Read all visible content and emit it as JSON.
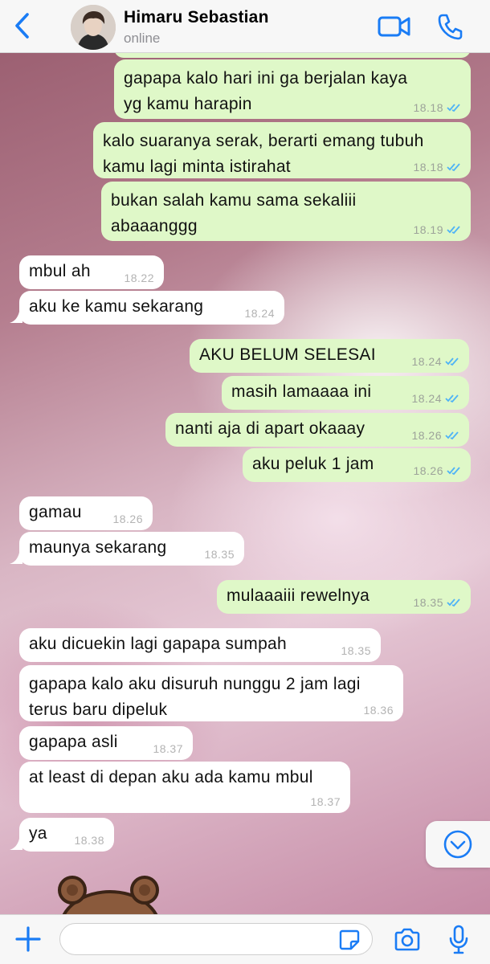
{
  "header": {
    "contact_name": "Himaru Sebastian",
    "status": "online",
    "back_icon": "chevron-left-icon",
    "video_icon": "video-camera-icon",
    "call_icon": "phone-icon",
    "accent_color": "#1a7cf5"
  },
  "messages": [
    {
      "dir": "out",
      "text": "gapapa kalo hari ini ga berjalan kaya yg kamu harapin",
      "time": "18.18",
      "read": true
    },
    {
      "dir": "out",
      "text": "kalo suaranya serak, berarti emang tubuh kamu lagi minta istirahat",
      "time": "18.18",
      "read": true
    },
    {
      "dir": "out",
      "text": "bukan salah kamu sama sekaliii abaaanggg",
      "time": "18.19",
      "read": true
    },
    {
      "dir": "in",
      "text": "mbul ah",
      "time": "18.22"
    },
    {
      "dir": "in",
      "text": "aku ke kamu sekarang",
      "time": "18.24"
    },
    {
      "dir": "out",
      "text": "AKU BELUM SELESAI",
      "time": "18.24",
      "read": true
    },
    {
      "dir": "out",
      "text": "masih lamaaaa ini",
      "time": "18.24",
      "read": true
    },
    {
      "dir": "out",
      "text": "nanti aja di apart okaaay",
      "time": "18.26",
      "read": true
    },
    {
      "dir": "out",
      "text": "aku peluk 1 jam",
      "time": "18.26",
      "read": true
    },
    {
      "dir": "in",
      "text": "gamau",
      "time": "18.26"
    },
    {
      "dir": "in",
      "text": "maunya sekarang",
      "time": "18.35"
    },
    {
      "dir": "out",
      "text": "mulaaaiii rewelnya",
      "time": "18.35",
      "read": true
    },
    {
      "dir": "in",
      "text": "aku dicuekin lagi gapapa sumpah",
      "time": "18.35"
    },
    {
      "dir": "in",
      "text": "gapapa kalo aku disuruh nunggu 2 jam lagi terus baru dipeluk",
      "time": "18.36"
    },
    {
      "dir": "in",
      "text": "gapapa asli",
      "time": "18.37"
    },
    {
      "dir": "in",
      "text": "at least di depan aku ada kamu mbul",
      "time": "18.37"
    },
    {
      "dir": "in",
      "text": "ya",
      "time": "18.38"
    }
  ],
  "colors": {
    "outgoing_bubble": "#dff8c8",
    "incoming_bubble": "#ffffff",
    "read_ticks": "#4fb3f6"
  },
  "scroll_down_icon": "chevron-down-circle-icon",
  "sticker_icon": "bear-sticker-icon",
  "input": {
    "placeholder": "",
    "value": "",
    "plus_icon": "plus-icon",
    "sticker_icon": "sticker-icon",
    "camera_icon": "camera-icon",
    "mic_icon": "microphone-icon"
  }
}
